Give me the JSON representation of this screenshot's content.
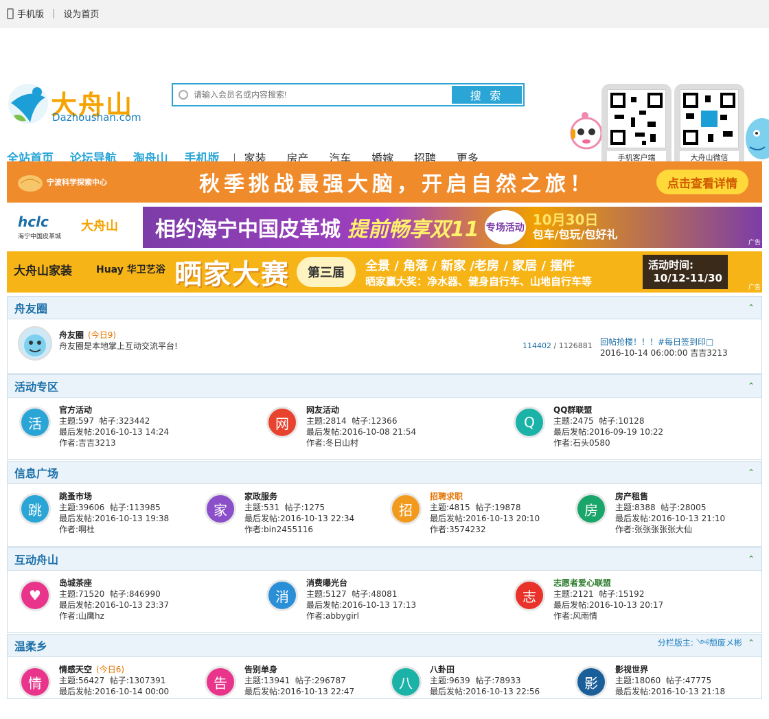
{
  "topbar": {
    "mobile": "手机版",
    "homepage": "设为首页"
  },
  "logo": {
    "name": "大舟山",
    "domain": "Dazhoushan.com"
  },
  "search": {
    "placeholder": "请输入会员名或内容搜索!",
    "button": "搜 索"
  },
  "qr": [
    {
      "caption": "手机客户端"
    },
    {
      "caption": "大舟山微信"
    }
  ],
  "nav": {
    "main": [
      "全站首页",
      "论坛导航",
      "淘舟山",
      "手机版"
    ],
    "sub": [
      "家装",
      "房产",
      "汽车",
      "婚嫁",
      "招聘",
      "更多"
    ]
  },
  "banners": [
    {
      "brand": "宁波科学探索中心",
      "text": "秋季挑战最强大脑，开启自然之旅！",
      "cta": "点击查看详情",
      "color": "#f08b2c"
    },
    {
      "brand": "海宁中国皮革城",
      "text": "相约海宁中国皮革城",
      "text2": "提前畅享双11",
      "badge": "专场活动",
      "date": "10月30日",
      "tag": "包车/包玩/包好礼",
      "ad": "广告"
    },
    {
      "brand": "大舟山家装",
      "brand2": "Huay 华卫艺浴",
      "text": "晒家大赛",
      "edition": "第三届",
      "line1": "全景 / 角落 / 新家 /老房 / 家居 / 摆件",
      "line2": "晒家赢大奖：净水器、健身自行车、山地自行车等",
      "time_label": "活动时间:",
      "time": "10/12-11/30",
      "ad": "广告"
    }
  ],
  "sections": {
    "zhouyouquan": {
      "title": "舟友圈",
      "forum": {
        "name": "舟友圈",
        "today": "(今日9)",
        "desc": "舟友圈是本地掌上互动交流平台!",
        "threads": "114402",
        "posts": "1126881",
        "last_title": "回帖抢楼！！！#每日签到印□",
        "last_time": "2016-10-14 06:00:00 吉吉3213"
      }
    },
    "huodong": {
      "title": "活动专区",
      "forums": [
        {
          "name": "官方活动",
          "topics": "主题:597",
          "posts": "帖子:323442",
          "last": "最后发帖:2016-10-13 14:24",
          "author": "作者:吉吉3213",
          "color": "#2aa5d6",
          "icon": "活"
        },
        {
          "name": "网友活动",
          "topics": "主题:2814",
          "posts": "帖子:12366",
          "last": "最后发帖:2016-10-08 21:54",
          "author": "作者:冬日山村",
          "color": "#e8432e",
          "icon": "网"
        },
        {
          "name": "QQ群联盟",
          "topics": "主题:2475",
          "posts": "帖子:10128",
          "last": "最后发帖:2016-09-19 10:22",
          "author": "作者:石头0580",
          "color": "#1bb3a8",
          "icon": "Q"
        }
      ]
    },
    "xinxi": {
      "title": "信息广场",
      "forums": [
        {
          "name": "跳蚤市场",
          "topics": "主题:39606",
          "posts": "帖子:113985",
          "last": "最后发帖:2016-10-13 19:38",
          "author": "作者:啊杜",
          "color": "#2aa5d6",
          "icon": "跳"
        },
        {
          "name": "家政服务",
          "topics": "主题:531",
          "posts": "帖子:1275",
          "last": "最后发帖:2016-10-13 22:34",
          "author": "作者:bin2455116",
          "color": "#8b4fc9",
          "icon": "家"
        },
        {
          "name": "招聘求职",
          "topics": "主题:4815",
          "posts": "帖子:19878",
          "last": "最后发帖:2016-10-13 20:10",
          "author": "作者:3574232",
          "color": "#f29a1e",
          "icon": "招",
          "orange": true
        },
        {
          "name": "房产租售",
          "topics": "主题:8388",
          "posts": "帖子:28005",
          "last": "最后发帖:2016-10-13 21:10",
          "author": "作者:张张张张张大仙",
          "color": "#1aa56b",
          "icon": "房"
        }
      ]
    },
    "hudong": {
      "title": "互动舟山",
      "forums": [
        {
          "name": "岛城茶座",
          "topics": "主题:71520",
          "posts": "帖子:846990",
          "last": "最后发帖:2016-10-13 23:37",
          "author": "作者:山鹰hz",
          "color": "#e8348a",
          "icon": "♥"
        },
        {
          "name": "消费曝光台",
          "topics": "主题:5127",
          "posts": "帖子:48081",
          "last": "最后发帖:2016-10-13 17:13",
          "author": "作者:abbygirl",
          "color": "#2a8fd6",
          "icon": "消"
        },
        {
          "name": "志愿者爱心联盟",
          "topics": "主题:2121",
          "posts": "帖子:15192",
          "last": "最后发帖:2016-10-13 20:17",
          "author": "作者:风雨情",
          "color": "#e8322a",
          "icon": "志",
          "green": true
        }
      ]
    },
    "wenrou": {
      "title": "温柔乡",
      "moderator": "分栏版主: ༺颓废メ彬",
      "forums": [
        {
          "name": "情感天空",
          "today": "(今日6)",
          "topics": "主题:56427",
          "posts": "帖子:1307391",
          "last": "最后发帖:2016-10-14 00:00",
          "color": "#e8348a",
          "icon": "情"
        },
        {
          "name": "告别单身",
          "topics": "主题:13941",
          "posts": "帖子:296787",
          "last": "最后发帖:2016-10-13 22:47",
          "color": "#e8348a",
          "icon": "告"
        },
        {
          "name": "八卦田",
          "topics": "主题:9639",
          "posts": "帖子:78933",
          "last": "最后发帖:2016-10-13 22:56",
          "color": "#1bb3a8",
          "icon": "八"
        },
        {
          "name": "影视世界",
          "topics": "主题:18060",
          "posts": "帖子:47775",
          "last": "最后发帖:2016-10-13 21:18",
          "color": "#1b5f9a",
          "icon": "影"
        }
      ]
    }
  }
}
